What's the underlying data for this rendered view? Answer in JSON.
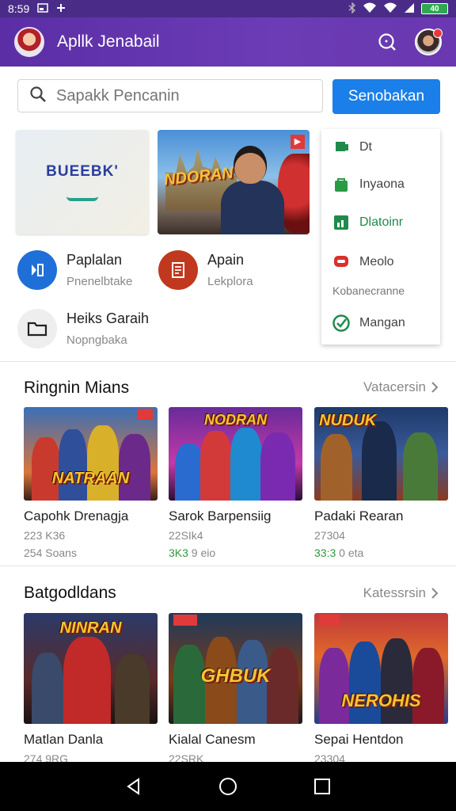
{
  "status_bar": {
    "time": "8:59",
    "battery": "40"
  },
  "app_bar": {
    "title": "Apllk Jenabail"
  },
  "search": {
    "placeholder": "Sapakk Pencanin",
    "button_label": "Senobakan"
  },
  "banner1": {
    "title": "BUEEBK'"
  },
  "banner2": {
    "title": "NDORAN"
  },
  "dropdown_menu": {
    "items": [
      {
        "label": "Dt",
        "icon": "bookmark-flag-icon"
      },
      {
        "label": "Inyaona",
        "icon": "bag-icon"
      },
      {
        "label": "Dlatoinr",
        "icon": "chart-icon"
      },
      {
        "label": "Meolo",
        "icon": "chat-icon"
      },
      {
        "label": "Mangan",
        "icon": "check-circle-icon"
      }
    ],
    "subtext": "Kobanecranne"
  },
  "shortcuts": [
    {
      "title": "Paplalan",
      "subtitle": "Pnenelbtake",
      "icon": "play-icon",
      "color": "#1f6fd9"
    },
    {
      "title": "Apain",
      "subtitle": "Lekplora",
      "icon": "document-icon",
      "color": "#c0391f"
    },
    {
      "title": "Heiks Garaih",
      "subtitle": "Nopngbaka",
      "icon": "folder-icon",
      "color": "#eeeeee"
    }
  ],
  "sections": [
    {
      "title": "Ringnin Mians",
      "link": "Vatacersin",
      "cards": [
        {
          "logo": "NATRAAN",
          "title": "Capohk Drenagja",
          "line1": "223 K36",
          "line2": "254 Soans",
          "green": ""
        },
        {
          "logo": "NODRAN",
          "title": "Sarok Barpensiig",
          "line1": "22SIk4",
          "line2": " 9 eio",
          "green": "3K3"
        },
        {
          "logo": "NUDUK",
          "title": "Padaki Rearan",
          "line1": "27304",
          "line2": " 0 eta",
          "green": "33:3"
        }
      ]
    },
    {
      "title": "Batgodldans",
      "link": "Katessrsin",
      "cards": [
        {
          "logo": "NINRAN",
          "title": "Matlan Danla",
          "line1": "274 9RG",
          "line2": "",
          "green": ""
        },
        {
          "logo": "GHBUK",
          "title": "Kialal Canesm",
          "line1": "22SRK",
          "line2": "",
          "green": ""
        },
        {
          "logo": "NEROHIS",
          "title": "Sepai Hentdon",
          "line1": "23304",
          "line2": "",
          "green": ""
        }
      ]
    }
  ],
  "colors": {
    "app_bar": "#5b2ea6",
    "accent": "#1a7fe8",
    "status_green": "#2e9a3a"
  }
}
